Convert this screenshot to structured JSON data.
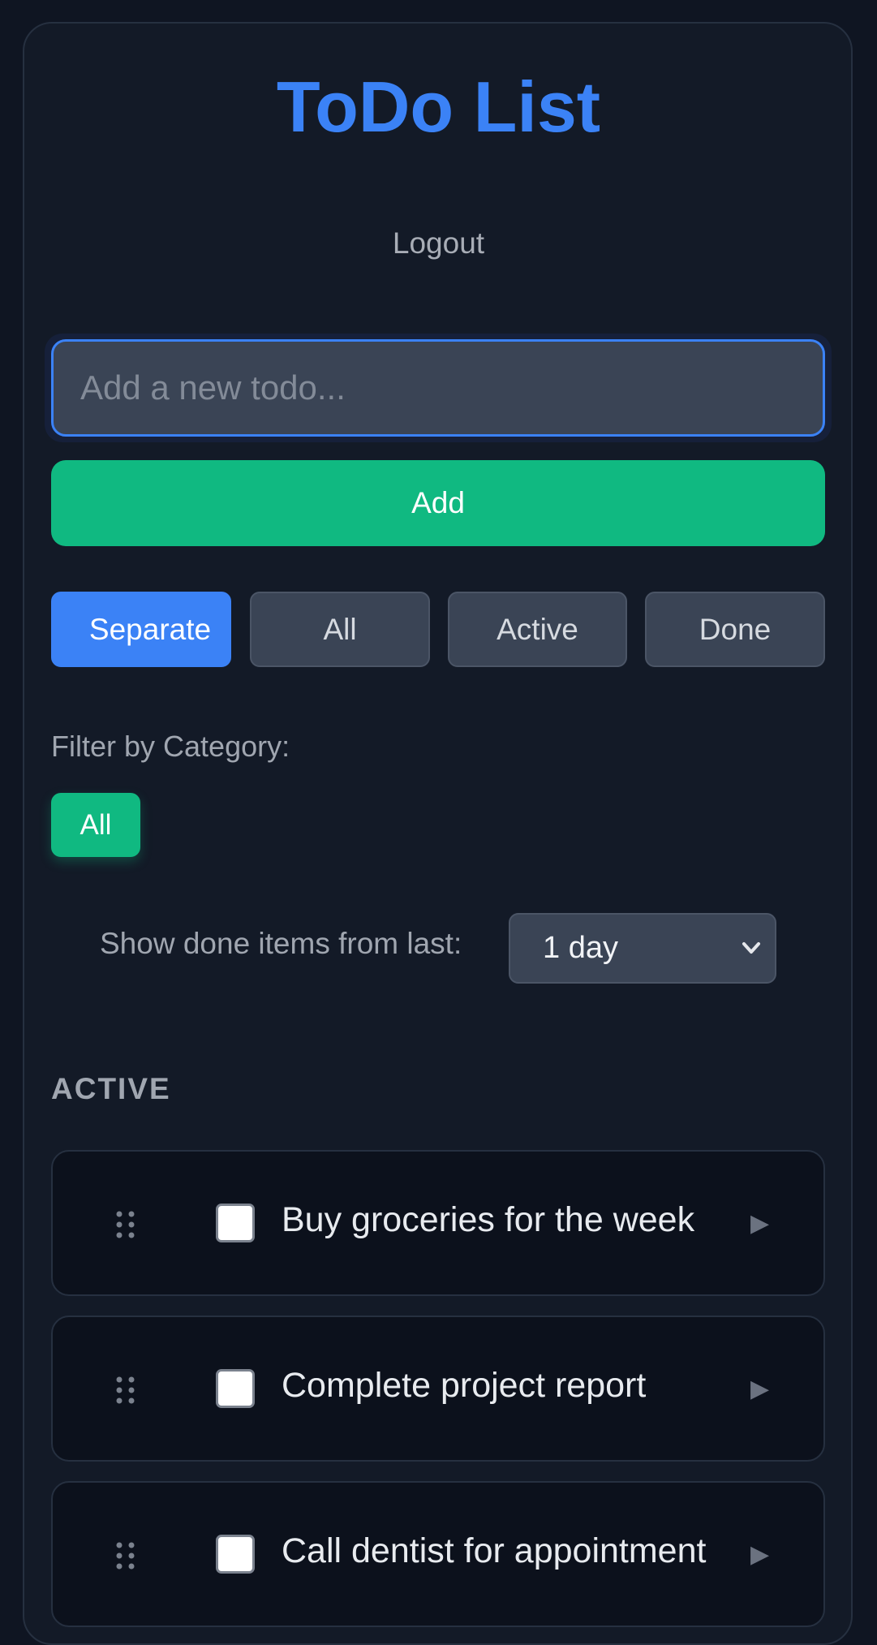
{
  "app": {
    "title": "ToDo List",
    "logout_label": "Logout"
  },
  "new_todo": {
    "placeholder": "Add a new todo...",
    "value": "",
    "add_label": "Add"
  },
  "view_modes": [
    {
      "label": "Separate",
      "selected": true
    },
    {
      "label": "All",
      "selected": false
    },
    {
      "label": "Active",
      "selected": false
    },
    {
      "label": "Done",
      "selected": false
    }
  ],
  "category_filter": {
    "label": "Filter by Category:",
    "options": [
      {
        "label": "All",
        "selected": true
      }
    ]
  },
  "done_range": {
    "label": "Show done items from last:",
    "selected": "1 day"
  },
  "sections": [
    {
      "heading": "ACTIVE",
      "items": [
        {
          "text": "Buy groceries for the week",
          "done": false
        },
        {
          "text": "Complete project report",
          "done": false
        },
        {
          "text": "Call dentist for appointment",
          "done": false
        }
      ]
    }
  ],
  "icons": {
    "drag": "grip-dots-icon",
    "expand": "play-triangle-icon",
    "select": "chevron-down-icon"
  },
  "colors": {
    "accent_blue": "#3b82f6",
    "accent_green": "#10b981",
    "background": "#131a27",
    "item_background": "#0c111c"
  }
}
